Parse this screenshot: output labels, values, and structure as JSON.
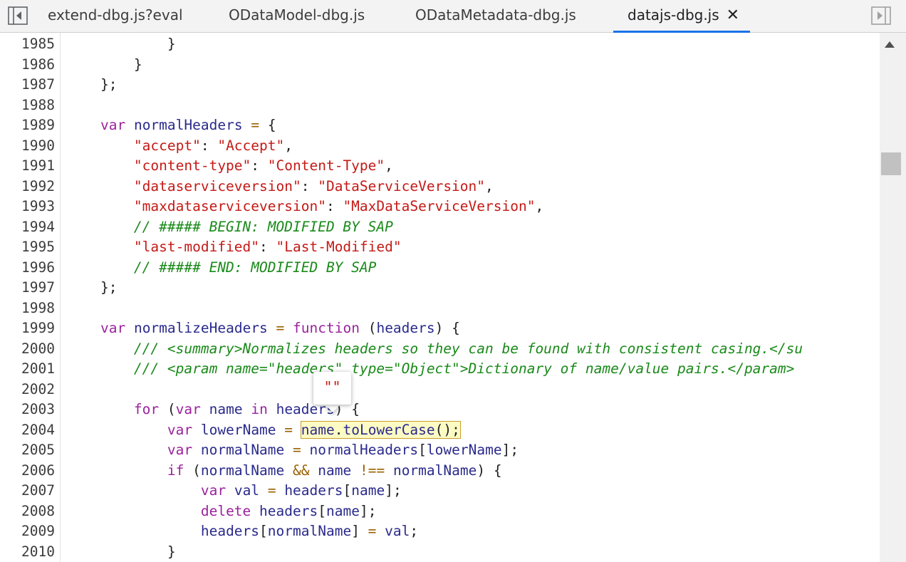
{
  "tabs": [
    {
      "label": "extend-dbg.js?eval",
      "active": false
    },
    {
      "label": "ODataModel-dbg.js",
      "active": false
    },
    {
      "label": "ODataMetadata-dbg.js",
      "active": false
    },
    {
      "label": "datajs-dbg.js",
      "active": true,
      "close_glyph": "✕"
    }
  ],
  "icons": {
    "left_nav": "sidebar-toggle-left-icon",
    "right_nav": "sidebar-toggle-right-icon",
    "scroll_up": "scroll-up-arrow-icon"
  },
  "tooltip": {
    "value": "\"\""
  },
  "lines": [
    {
      "n": "1985",
      "text": "            }"
    },
    {
      "n": "1986",
      "text": "        }"
    },
    {
      "n": "1987",
      "text": "    };"
    },
    {
      "n": "1988",
      "text": ""
    },
    {
      "n": "1989",
      "text": "    var normalHeaders = {"
    },
    {
      "n": "1990",
      "text": "        \"accept\": \"Accept\","
    },
    {
      "n": "1991",
      "text": "        \"content-type\": \"Content-Type\","
    },
    {
      "n": "1992",
      "text": "        \"dataserviceversion\": \"DataServiceVersion\","
    },
    {
      "n": "1993",
      "text": "        \"maxdataserviceversion\": \"MaxDataServiceVersion\","
    },
    {
      "n": "1994",
      "text": "        // ##### BEGIN: MODIFIED BY SAP"
    },
    {
      "n": "1995",
      "text": "        \"last-modified\": \"Last-Modified\""
    },
    {
      "n": "1996",
      "text": "        // ##### END: MODIFIED BY SAP"
    },
    {
      "n": "1997",
      "text": "    };"
    },
    {
      "n": "1998",
      "text": ""
    },
    {
      "n": "1999",
      "text": "    var normalizeHeaders = function (headers) {"
    },
    {
      "n": "2000",
      "text": "        /// <summary>Normalizes headers so they can be found with consistent casing.</su"
    },
    {
      "n": "2001",
      "text": "        /// <param name=\"headers\" type=\"Object\">Dictionary of name/value pairs.</param>"
    },
    {
      "n": "2002",
      "text": ""
    },
    {
      "n": "2003",
      "text": "        for (var name in headers) {"
    },
    {
      "n": "2004",
      "text": "            var lowerName = name.toLowerCase();"
    },
    {
      "n": "2005",
      "text": "            var normalName = normalHeaders[lowerName];"
    },
    {
      "n": "2006",
      "text": "            if (normalName && name !== normalName) {"
    },
    {
      "n": "2007",
      "text": "                var val = headers[name];"
    },
    {
      "n": "2008",
      "text": "                delete headers[name];"
    },
    {
      "n": "2009",
      "text": "                headers[normalName] = val;"
    },
    {
      "n": "2010",
      "text": "            }"
    }
  ]
}
